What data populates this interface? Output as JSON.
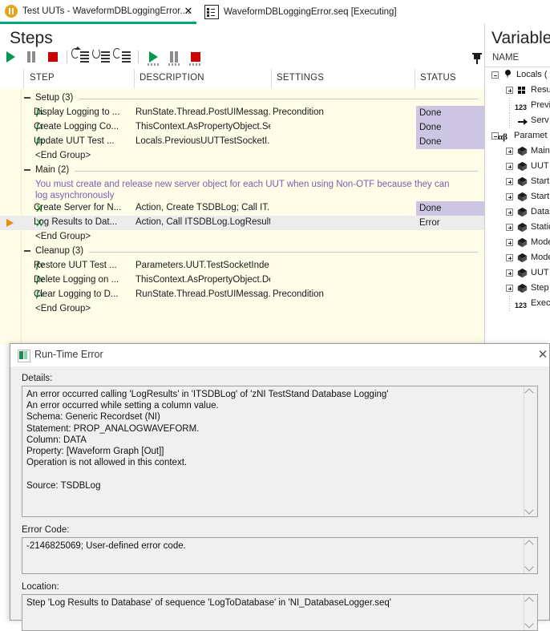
{
  "tabs": [
    {
      "label": "Test UUTs - WaveformDBLoggingError....",
      "icon": "pause-circle-icon",
      "active": true,
      "closable": true
    },
    {
      "label": "WaveformDBLoggingError.seq [Executing]",
      "icon": "sequence-file-icon",
      "active": false,
      "closable": false
    }
  ],
  "close_glyph": "✕",
  "steps_pane": {
    "title": "Steps",
    "pin_icon": "pushpin-icon",
    "toolbar": [
      {
        "name": "run-button",
        "icon": "play-icon"
      },
      {
        "name": "break-button",
        "icon": "pause-icon"
      },
      {
        "name": "terminate-button",
        "icon": "stop-icon"
      },
      {
        "name": "step-into-button",
        "icon": "step-into-icon"
      },
      {
        "name": "step-over-button",
        "icon": "step-over-icon"
      },
      {
        "name": "step-out-button",
        "icon": "step-out-icon"
      },
      {
        "name": "resume-all-button",
        "icon": "play-dotted-icon"
      },
      {
        "name": "break-all-button",
        "icon": "pause-dotted-icon"
      },
      {
        "name": "terminate-all-button",
        "icon": "stop-dotted-icon"
      }
    ],
    "columns": [
      "STEP",
      "DESCRIPTION",
      "SETTINGS",
      "STATUS"
    ],
    "rows": [
      {
        "kind": "group",
        "label": "Setup (3)",
        "expanded": true
      },
      {
        "kind": "step",
        "icon": "fx",
        "step": "Display Logging to ...",
        "description": "RunState.Thread.PostUIMessag...",
        "settings": "Precondition",
        "status": "Done"
      },
      {
        "kind": "step",
        "icon": "fx",
        "step": "Create Logging Co...",
        "description": "ThisContext.AsPropertyObject.Se...",
        "settings": "",
        "status": "Done"
      },
      {
        "kind": "step",
        "icon": "fx",
        "step": "Update UUT Test ...",
        "description": "Locals.PreviousUUTTestSocketI...",
        "settings": "",
        "status": "Done"
      },
      {
        "kind": "endgroup",
        "label": "<End Group>"
      },
      {
        "kind": "group",
        "label": "Main (2)",
        "expanded": true
      },
      {
        "kind": "comment",
        "label": "You must create and release new server object for each UUT when using Non-OTF because they can log asynchronously"
      },
      {
        "kind": "step",
        "icon": "x",
        "step": "Create Server for N...",
        "description": "Action,  Create TSDBLog; Call IT...",
        "settings": "",
        "status": "Done"
      },
      {
        "kind": "step",
        "icon": "x",
        "step": "Log Results to Dat...",
        "description": "Action,  Call ITSDBLog.LogResults",
        "settings": "",
        "status": "Error",
        "selected": true,
        "marker": true
      },
      {
        "kind": "endgroup",
        "label": "<End Group>"
      },
      {
        "kind": "group",
        "label": "Cleanup (3)",
        "expanded": true
      },
      {
        "kind": "step",
        "icon": "fx",
        "step": "Restore UUT Test ...",
        "description": "Parameters.UUT.TestSocketInde...",
        "settings": "",
        "status": ""
      },
      {
        "kind": "step",
        "icon": "fx",
        "step": "Delete Logging on ...",
        "description": "ThisContext.AsPropertyObject.De...",
        "settings": "",
        "status": ""
      },
      {
        "kind": "step",
        "icon": "fx",
        "step": "Clear Logging to D...",
        "description": "RunState.Thread.PostUIMessag...",
        "settings": "Precondition",
        "status": ""
      },
      {
        "kind": "endgroup",
        "label": "<End Group>"
      }
    ]
  },
  "variables_pane": {
    "title": "Variables",
    "column_header": "NAME",
    "tree": [
      {
        "indent": 0,
        "expander": "minus",
        "icon": "location-pin-icon",
        "label": "Locals ("
      },
      {
        "indent": 1,
        "expander": "plus",
        "icon": "grid-icon",
        "label": "Resu"
      },
      {
        "indent": 1,
        "expander": "none",
        "icon": "number-icon",
        "label": "Previ"
      },
      {
        "indent": 1,
        "expander": "none",
        "icon": "reference-arrow-icon",
        "label": "Serv"
      },
      {
        "indent": 0,
        "expander": "minus",
        "icon": "alpha-beta-icon",
        "label": "Paramet"
      },
      {
        "indent": 1,
        "expander": "plus",
        "icon": "object-cube-icon",
        "label": "Main"
      },
      {
        "indent": 1,
        "expander": "plus",
        "icon": "object-cube-icon",
        "label": "UUT"
      },
      {
        "indent": 1,
        "expander": "plus",
        "icon": "object-cube-icon",
        "label": "Start"
      },
      {
        "indent": 1,
        "expander": "plus",
        "icon": "object-cube-icon",
        "label": "Start"
      },
      {
        "indent": 1,
        "expander": "plus",
        "icon": "object-cube-icon",
        "label": "Data"
      },
      {
        "indent": 1,
        "expander": "plus",
        "icon": "object-cube-icon",
        "label": "Static"
      },
      {
        "indent": 1,
        "expander": "plus",
        "icon": "object-cube-icon",
        "label": "Mode"
      },
      {
        "indent": 1,
        "expander": "plus",
        "icon": "object-cube-icon",
        "label": "Mode"
      },
      {
        "indent": 1,
        "expander": "plus",
        "icon": "object-cube-icon",
        "label": "UUT"
      },
      {
        "indent": 1,
        "expander": "plus",
        "icon": "object-cube-icon",
        "label": "Step"
      },
      {
        "indent": 1,
        "expander": "none",
        "icon": "number-icon",
        "label": "Exec"
      }
    ]
  },
  "dialog": {
    "title": "Run-Time Error",
    "icon": "runtime-error-icon",
    "close_glyph": "✕",
    "details_label": "Details:",
    "details_text": "An error occurred calling 'LogResults' in 'ITSDBLog' of 'zNI TestStand Database Logging'\nAn error occurred while setting a column value.\nSchema: Generic Recordset (NI)\nStatement: PROP_ANALOGWAVEFORM.\nColumn: DATA\nProperty: [Waveform Graph [Out]]\nOperation is not allowed in this context.\n\nSource: TSDBLog",
    "error_code_label": "Error Code:",
    "error_code_text": "-2146825069; User-defined error code.",
    "location_label": "Location:",
    "location_text": "Step 'Log Results to Database' of sequence 'LogToDatabase' in 'NI_DatabaseLogger.seq'"
  },
  "colors": {
    "accent_green": "#00a878",
    "status_done_bg": "#cdc6e3",
    "steplist_bg": "#fffde8",
    "comment_text": "#7a5fb0",
    "marker_orange": "#e8900c"
  }
}
